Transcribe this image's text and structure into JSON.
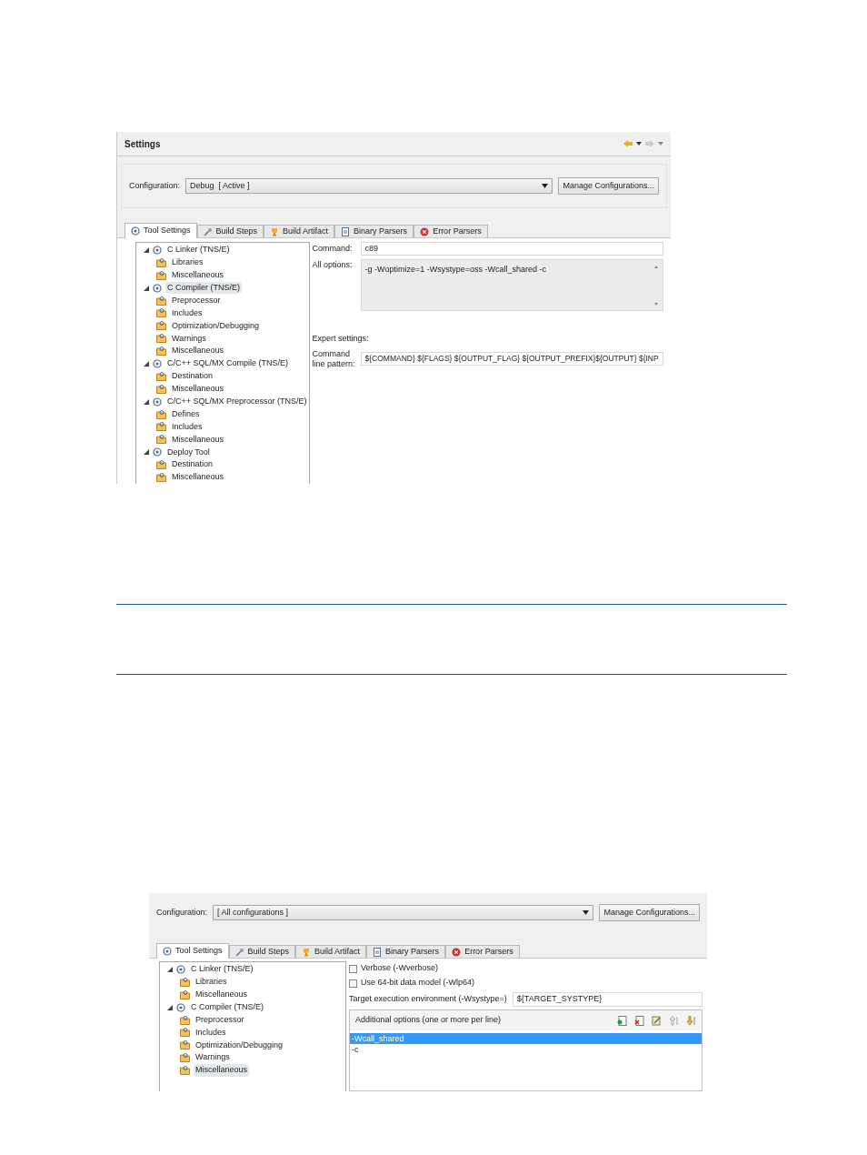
{
  "screenshot_1": {
    "title": "Settings",
    "configuration": {
      "label": "Configuration:",
      "value": "Debug  [ Active ]",
      "button": "Manage Configurations..."
    },
    "tabs": [
      {
        "label": "Tool Settings",
        "selected": true
      },
      {
        "label": "Build Steps",
        "selected": false
      },
      {
        "label": "Build Artifact",
        "selected": false
      },
      {
        "label": "Binary Parsers",
        "selected": false
      },
      {
        "label": "Error Parsers",
        "selected": false
      }
    ],
    "tree": [
      {
        "label": "C Linker (TNS/E)",
        "expanded": true,
        "selected": false,
        "children": [
          {
            "label": "Libraries",
            "selected": false
          },
          {
            "label": "Miscellaneous",
            "selected": false
          }
        ]
      },
      {
        "label": "C Compiler (TNS/E)",
        "expanded": true,
        "selected": true,
        "children": [
          {
            "label": "Preprocessor",
            "selected": false
          },
          {
            "label": "Includes",
            "selected": false
          },
          {
            "label": "Optimization/Debugging",
            "selected": false
          },
          {
            "label": "Warnings",
            "selected": false
          },
          {
            "label": "Miscellaneous",
            "selected": false
          }
        ]
      },
      {
        "label": "C/C++ SQL/MX Compile (TNS/E)",
        "expanded": true,
        "selected": false,
        "children": [
          {
            "label": "Destination",
            "selected": false
          },
          {
            "label": "Miscellaneous",
            "selected": false
          }
        ]
      },
      {
        "label": "C/C++ SQL/MX Preprocessor (TNS/E)",
        "expanded": true,
        "selected": false,
        "children": [
          {
            "label": "Defines",
            "selected": false
          },
          {
            "label": "Includes",
            "selected": false
          },
          {
            "label": "Miscellaneous",
            "selected": false
          }
        ]
      },
      {
        "label": "Deploy Tool",
        "expanded": true,
        "selected": false,
        "children": [
          {
            "label": "Destination",
            "selected": false
          },
          {
            "label": "Miscellaneous",
            "selected": false
          }
        ]
      }
    ],
    "command": {
      "label": "Command:",
      "value": "c89"
    },
    "all_options": {
      "label": "All options:",
      "value": "-g -Woptimize=1 -Wsystype=oss -Wcall_shared -c"
    },
    "expert_settings": "Expert settings:",
    "command_line_pattern": {
      "label": "Command line pattern:",
      "value": "${COMMAND} ${FLAGS} ${OUTPUT_FLAG} ${OUTPUT_PREFIX}${OUTPUT} ${INP"
    }
  },
  "screenshot_2": {
    "configuration": {
      "label": "Configuration:",
      "value": "[ All configurations ]",
      "button": "Manage Configurations..."
    },
    "tabs": [
      {
        "label": "Tool Settings",
        "selected": true
      },
      {
        "label": "Build Steps",
        "selected": false
      },
      {
        "label": "Build Artifact",
        "selected": false
      },
      {
        "label": "Binary Parsers",
        "selected": false
      },
      {
        "label": "Error Parsers",
        "selected": false
      }
    ],
    "tree": [
      {
        "label": "C Linker (TNS/E)",
        "expanded": true,
        "selected": false,
        "children": [
          {
            "label": "Libraries",
            "selected": false
          },
          {
            "label": "Miscellaneous",
            "selected": false
          }
        ]
      },
      {
        "label": "C Compiler (TNS/E)",
        "expanded": true,
        "selected": false,
        "children": [
          {
            "label": "Preprocessor",
            "selected": false
          },
          {
            "label": "Includes",
            "selected": false
          },
          {
            "label": "Optimization/Debugging",
            "selected": false
          },
          {
            "label": "Warnings",
            "selected": false
          },
          {
            "label": "Miscellaneous",
            "selected": true
          }
        ]
      }
    ],
    "checkboxes": [
      {
        "label": "Verbose (-Wverbose)",
        "checked": false
      },
      {
        "label": "Use 64-bit data model (-Wlp64)",
        "checked": false
      }
    ],
    "target_environment": {
      "label": "Target execution environment (-Wsystype=)",
      "value": "${TARGET_SYSTYPE}"
    },
    "additional_options": {
      "title": "Additional options (one or more per line)",
      "items": [
        {
          "label": "-Wcall_shared",
          "selected": true
        },
        {
          "label": "-c",
          "selected": false
        }
      ]
    }
  }
}
